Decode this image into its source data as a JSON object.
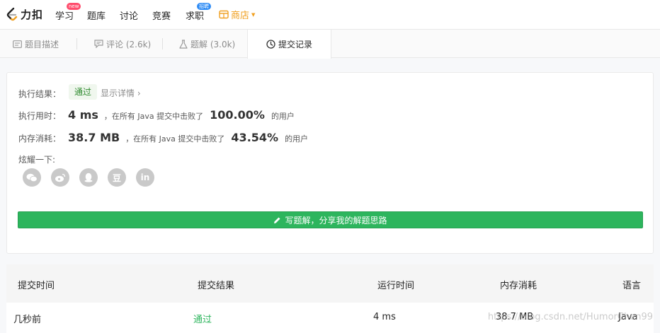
{
  "nav": {
    "logo_text": "力扣",
    "items": [
      {
        "label": "学习",
        "badge": "new"
      },
      {
        "label": "题库"
      },
      {
        "label": "讨论"
      },
      {
        "label": "竞赛"
      },
      {
        "label": "求职",
        "badge": "招聘"
      }
    ],
    "shop_label": "商店",
    "colors": {
      "accent": "#f0a020",
      "badge_new": "#ff4d6d",
      "badge_hire": "#2f8cf5"
    }
  },
  "tabs": [
    {
      "label": "题目描述",
      "icon": "description-icon"
    },
    {
      "label": "评论 (2.6k)",
      "icon": "comment-icon"
    },
    {
      "label": "题解 (3.0k)",
      "icon": "flask-icon"
    },
    {
      "label": "提交记录",
      "icon": "clock-icon",
      "active": true
    }
  ],
  "result": {
    "status_label": "执行结果：",
    "status_value": "通过",
    "detail_link": "显示详情 ›",
    "runtime_label": "执行用时：",
    "runtime_value": "4 ms",
    "runtime_mid": "，在所有 Java 提交中击败了",
    "runtime_pct": "100.00%",
    "runtime_suffix": "的用户",
    "memory_label": "内存消耗：",
    "memory_value": "38.7 MB",
    "memory_mid": "，在所有 Java 提交中击败了",
    "memory_pct": "43.54%",
    "memory_suffix": "的用户",
    "share_label": "炫耀一下:",
    "share_icons": [
      "wechat-icon",
      "weibo-icon",
      "qq-icon",
      "douban-icon",
      "linkedin-icon"
    ],
    "share_glyphs": [
      "",
      "",
      "",
      "豆",
      "in"
    ],
    "write_button": "写题解，分享我的解题思路",
    "colors": {
      "pass": "#2db55d",
      "pill_bg": "#f0f7ee"
    }
  },
  "table": {
    "headers": [
      "提交时间",
      "提交结果",
      "运行时间",
      "内存消耗",
      "语言"
    ],
    "rows": [
      [
        "几秒前",
        "通过",
        "4 ms",
        "38.7 MB",
        "Java"
      ]
    ]
  },
  "watermark": "https://blog.csdn.net/HumorChen99"
}
